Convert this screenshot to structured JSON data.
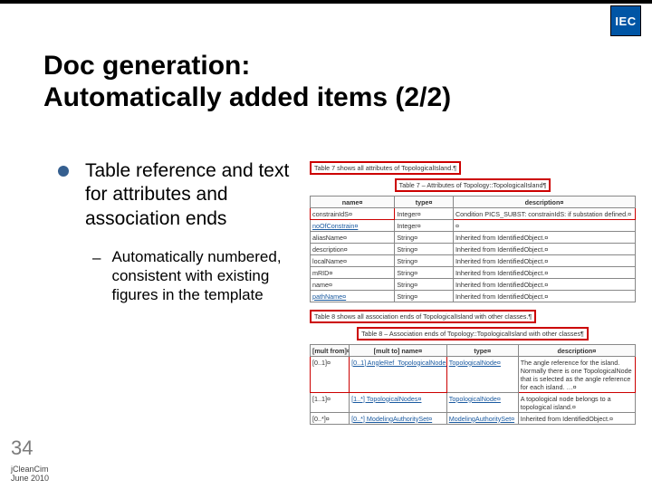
{
  "logo_text": "IEC",
  "title_line1": "Doc generation:",
  "title_line2": "Automatically added items (2/2)",
  "bullet_main": "Table reference and text for attributes and association ends",
  "bullet_sub": "Automatically numbered, consistent with existing figures in the template",
  "page_number": "34",
  "footer_line1": "jCleanCim",
  "footer_line2": "June 2010",
  "table7": {
    "caption_ref": "Table 7 shows all attributes of TopologicalIsland.¶",
    "caption_title": "Table 7 – Attributes of Topology::TopologicalIsland¶",
    "headers": [
      "name¤",
      "type¤",
      "description¤"
    ],
    "rows": [
      [
        "constrainIdS¤",
        "Integer¤",
        "Condition PICS_SUBST: constrainIdS: if substation defined.¤"
      ],
      [
        "noOfConstrain¤",
        "Integer¤",
        "¤"
      ],
      [
        "aliasName¤",
        "String¤",
        "Inherited from IdentifiedObject.¤"
      ],
      [
        "description¤",
        "String¤",
        "Inherited from IdentifiedObject.¤"
      ],
      [
        "localName¤",
        "String¤",
        "Inherited from IdentifiedObject.¤"
      ],
      [
        "mRID¤",
        "String¤",
        "Inherited from IdentifiedObject.¤"
      ],
      [
        "name¤",
        "String¤",
        "Inherited from IdentifiedObject.¤"
      ],
      [
        "pathName¤",
        "String¤",
        "Inherited from IdentifiedObject.¤"
      ]
    ]
  },
  "table8": {
    "caption_ref": "Table 8 shows all association ends of TopologicalIsland with other classes.¶",
    "caption_title": "Table 8 – Association ends of Topology::TopologicalIsland with other classes¶",
    "headers": [
      "[mult from]¤",
      "[mult to] name¤",
      "type¤",
      "description¤"
    ],
    "rows": [
      [
        "[0..1]¤",
        "[0..1] AngleRef_TopologicalNode¤",
        "TopologicalNode¤",
        "The angle reference for the island. Normally there is one TopologicalNode that is selected as the angle reference for each island. …¤"
      ],
      [
        "[1..1]¤",
        "[1..*] TopologicalNodes¤",
        "TopologicalNode¤",
        "A topological node belongs to a topological island.¤"
      ],
      [
        "[0..*]¤",
        "[0..*] ModelingAuthoritySet¤",
        "ModelingAuthoritySet¤",
        "Inherited from IdentifiedObject.¤"
      ]
    ]
  }
}
